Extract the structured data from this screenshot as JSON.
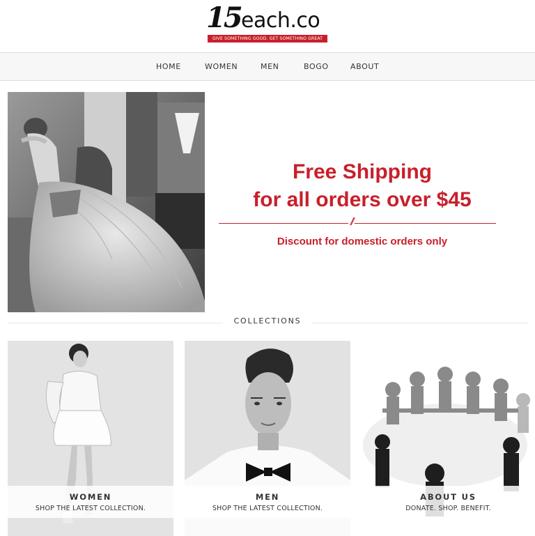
{
  "logo": {
    "number": "15",
    "name": "each.co",
    "tagline": "GIVE SOMETHING GOOD. GET SOMETHING GREAT"
  },
  "nav": {
    "items": [
      {
        "label": "HOME"
      },
      {
        "label": "WOMEN"
      },
      {
        "label": "MEN"
      },
      {
        "label": "BOGO"
      },
      {
        "label": "ABOUT"
      }
    ]
  },
  "promo": {
    "line1": "Free Shipping",
    "line2": "for all orders over $45",
    "divider_mark": "//",
    "subtext": "Discount for domestic orders only"
  },
  "collections": {
    "heading": "COLLECTIONS",
    "cards": [
      {
        "title": "WOMEN",
        "subtitle": "SHOP THE LATEST COLLECTION."
      },
      {
        "title": "MEN",
        "subtitle": "SHOP THE LATEST COLLECTION."
      },
      {
        "title": "ABOUT US",
        "subtitle": "DONATE. SHOP. BENEFIT."
      }
    ]
  },
  "colors": {
    "accent": "#c8202b",
    "nav_background": "#f7f7f7",
    "text": "#333333"
  }
}
